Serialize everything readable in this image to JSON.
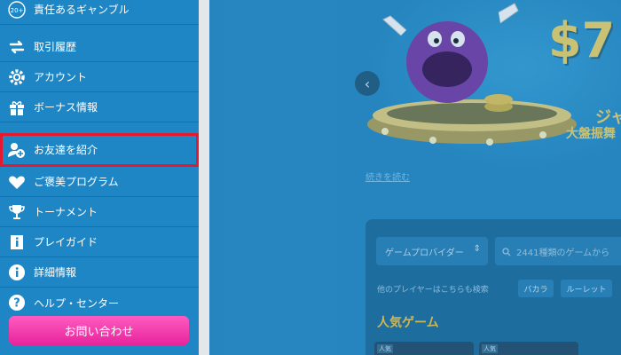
{
  "sidebar": {
    "items": [
      {
        "label": "責任あるギャンブル",
        "icon": "age-20-plus-icon"
      },
      {
        "label": "取引履歴",
        "icon": "transfer-arrows-icon"
      },
      {
        "label": "アカウント",
        "icon": "settings-gear-icon"
      },
      {
        "label": "ボーナス情報",
        "icon": "gift-icon"
      },
      {
        "label": "お友達を紹介",
        "icon": "add-user-icon"
      },
      {
        "label": "ご褒美プログラム",
        "icon": "heart-icon"
      },
      {
        "label": "トーナメント",
        "icon": "trophy-icon"
      },
      {
        "label": "プレイガイド",
        "icon": "guide-book-icon"
      },
      {
        "label": "詳細情報",
        "icon": "info-icon"
      },
      {
        "label": "ヘルプ・センター",
        "icon": "help-icon"
      }
    ],
    "age_badge": "20+",
    "contact_button": "お問い合わせ"
  },
  "main": {
    "banner": {
      "amount": "$7",
      "jp_line1": "ジャ",
      "jp_line2": "大盤振舞",
      "read_more": "続きを読む"
    },
    "games": {
      "provider_select": "ゲームプロバイダー",
      "search_placeholder": "2441種類のゲームから",
      "search_by": "他のプレイヤーはこちらも検索",
      "chips": [
        "バカラ",
        "ルーレット"
      ],
      "popular_title": "人気ゲーム",
      "thumb_tag": "人気"
    }
  },
  "colors": {
    "sidebar_bg": "#1e86c4",
    "highlight": "#e3192f",
    "contact_button": "#ff3fb0",
    "accent_gold": "#f6c744"
  }
}
